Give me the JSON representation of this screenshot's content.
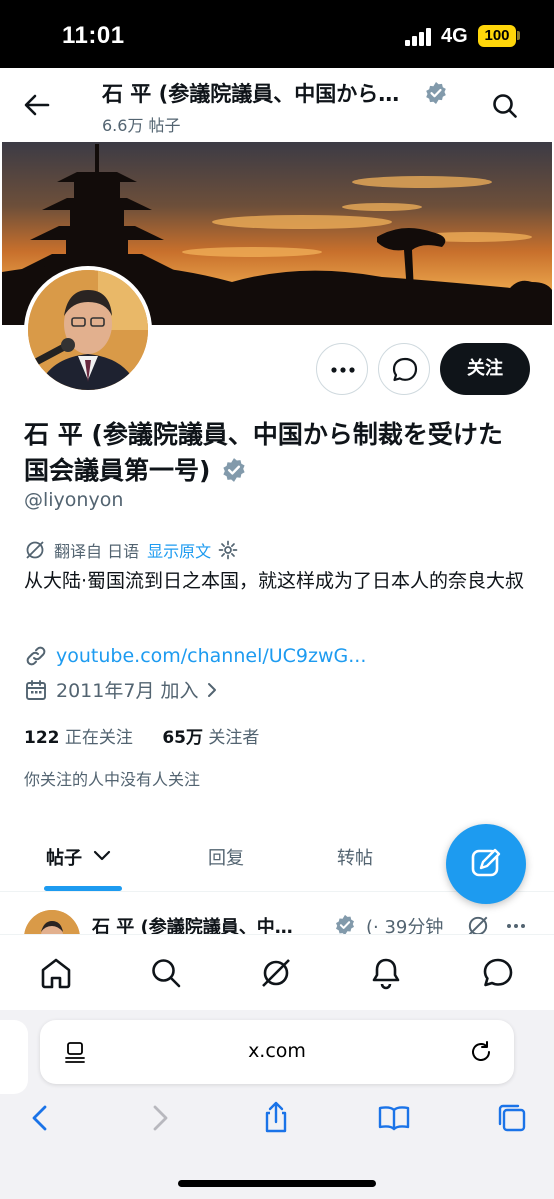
{
  "status_bar": {
    "time": "11:01",
    "network": "4G",
    "battery": "100"
  },
  "header": {
    "title": "石 平 (参議院議員、中国から…",
    "post_count": "6.6万 帖子"
  },
  "profile": {
    "display_name": "石 平 (参議院議員、中国から制裁を受けた国会議員第一号)",
    "handle": "@liyonyon",
    "translated_from": "翻译自 日语",
    "show_original": "显示原文",
    "bio": "从大陆·蜀国流到日之本国，就这样成为了日本人的奈良大叔",
    "link": "youtube.com/channel/UC9zwG...",
    "joined": "2011年7月 加入",
    "following_count": "122",
    "following_label": "正在关注",
    "followers_count": "65万",
    "followers_label": "关注者",
    "followed_by": "你关注的人中没有人关注"
  },
  "actions": {
    "follow_label": "关注"
  },
  "tabs": [
    {
      "label": "帖子",
      "active": true
    },
    {
      "label": "回复",
      "active": false
    },
    {
      "label": "转帖",
      "active": false
    }
  ],
  "tweet_preview": {
    "name": "石 平 (参議院議員、中…",
    "meta": "(· 39分钟"
  },
  "browser": {
    "url": "x.com"
  },
  "colors": {
    "accent": "#1d9bf0",
    "text": "#0f1419",
    "muted": "#536471",
    "battery": "#ffd60a"
  },
  "icons": {
    "nav": [
      "home-icon",
      "search-icon",
      "grok-icon",
      "bell-icon",
      "messages-icon"
    ],
    "toolbar": [
      "back-icon",
      "forward-icon",
      "share-icon",
      "bookmarks-icon",
      "tabs-icon"
    ]
  }
}
